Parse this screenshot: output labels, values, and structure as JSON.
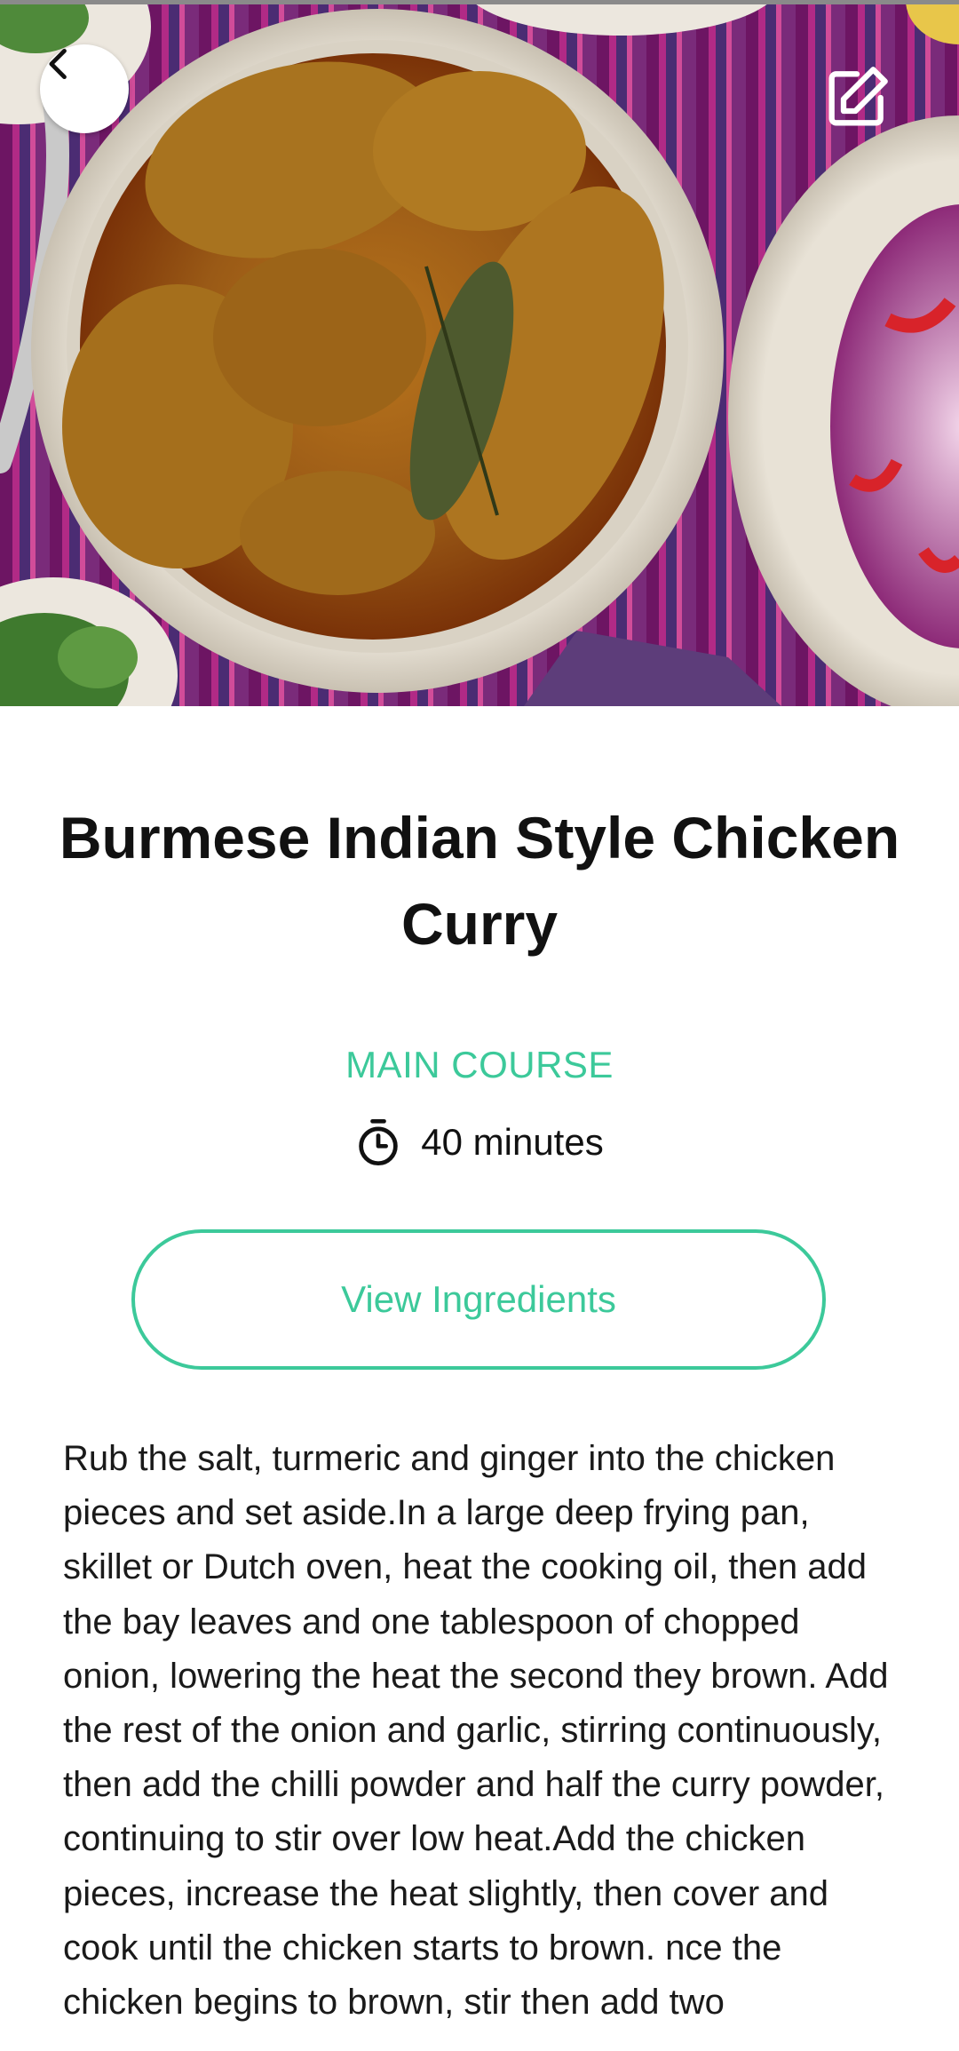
{
  "recipe": {
    "title": "Burmese Indian Style Chicken Curry",
    "category": "MAIN COURSE",
    "time": "40 minutes",
    "instructions": "Rub the salt, turmeric and ginger into the chicken pieces and set aside.In a large deep frying pan, skillet or Dutch oven, heat the cooking oil, then add the bay leaves and one tablespoon of chopped onion, lowering the heat the second they brown. Add the rest of the onion and garlic, stirring continuously, then add the chilli powder and half the curry powder, continuing to stir over low heat.Add the chicken pieces, increase the heat slightly, then cover and cook until the chicken starts to brown. nce the chicken begins to brown, stir then add two"
  },
  "actions": {
    "view_ingredients_label": "View Ingredients"
  },
  "icons": {
    "back": "chevron-left-icon",
    "edit": "edit-icon",
    "timer": "stopwatch-icon"
  },
  "colors": {
    "accent": "#3cc99a",
    "text": "#111111"
  }
}
